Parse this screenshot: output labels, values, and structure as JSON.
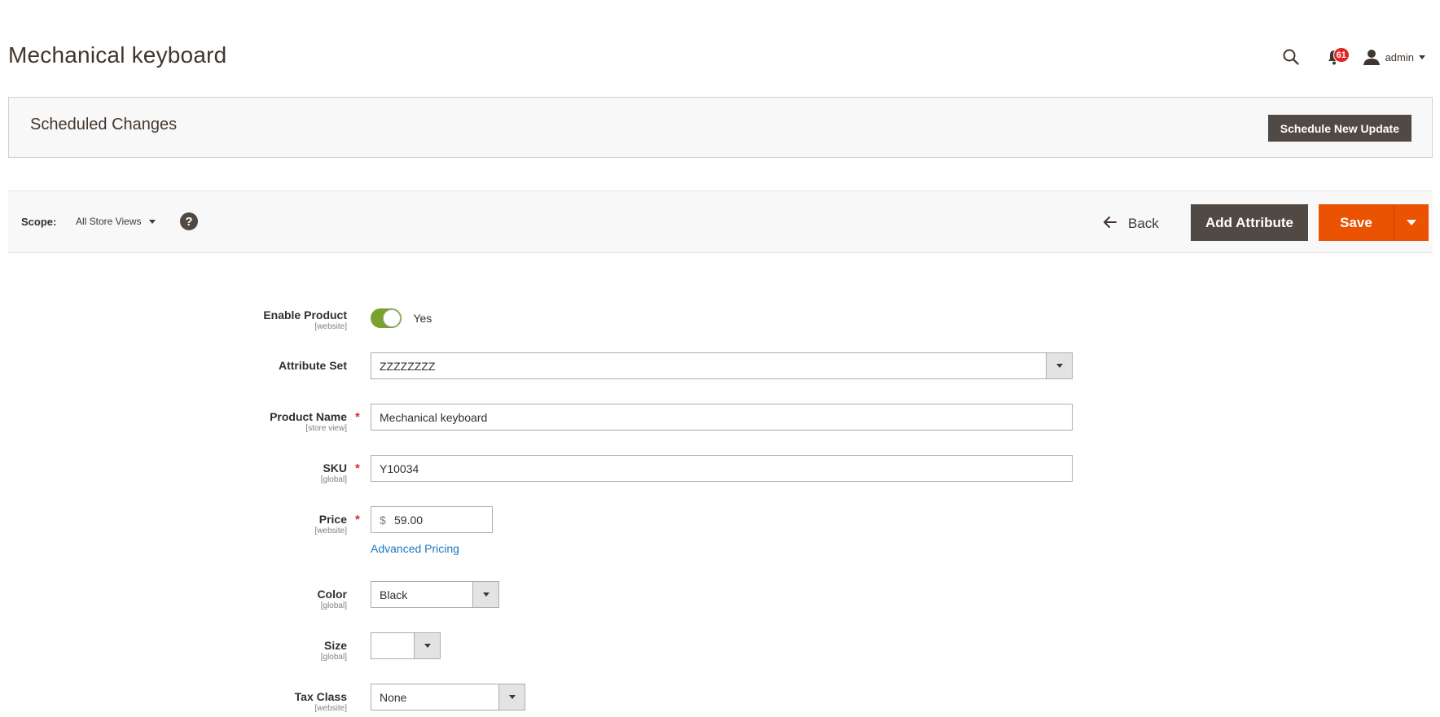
{
  "header": {
    "title": "Mechanical keyboard",
    "notifications_count": "61",
    "user_name": "admin"
  },
  "scheduled_changes": {
    "title": "Scheduled Changes",
    "button_label": "Schedule New Update"
  },
  "action_bar": {
    "scope_label": "Scope:",
    "scope_value": "All Store Views",
    "help_symbol": "?",
    "back_label": "Back",
    "add_attribute_label": "Add Attribute",
    "save_label": "Save"
  },
  "form": {
    "enable_product": {
      "label": "Enable Product",
      "scope": "[website]",
      "value_text": "Yes"
    },
    "attribute_set": {
      "label": "Attribute Set",
      "value": "ZZZZZZZZ"
    },
    "product_name": {
      "label": "Product Name",
      "scope": "[store view]",
      "value": "Mechanical keyboard",
      "required": "*"
    },
    "sku": {
      "label": "SKU",
      "scope": "[global]",
      "value": "Y10034",
      "required": "*"
    },
    "price": {
      "label": "Price",
      "scope": "[website]",
      "currency": "$",
      "value": "59.00",
      "required": "*",
      "advanced_link": "Advanced Pricing"
    },
    "color": {
      "label": "Color",
      "scope": "[global]",
      "value": "Black"
    },
    "size": {
      "label": "Size",
      "scope": "[global]",
      "value": ""
    },
    "tax_class": {
      "label": "Tax Class",
      "scope": "[website]",
      "value": "None"
    }
  },
  "colors": {
    "primary_button": "#514943",
    "save_button": "#eb5202",
    "toggle_on": "#79a22e",
    "link": "#1979c3",
    "badge": "#e22626"
  }
}
